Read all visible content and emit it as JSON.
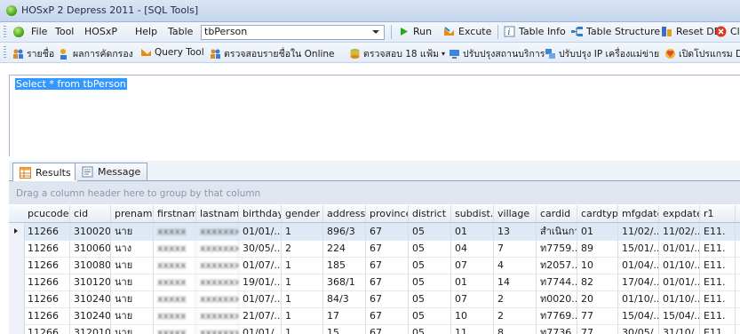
{
  "window": {
    "title": "HOSxP 2 Depress 2011 - [SQL Tools]"
  },
  "menu": {
    "items": [
      "File",
      "Tool",
      "HOSxP",
      "Help",
      "Table"
    ],
    "table_select": "tbPerson",
    "buttons": [
      "Run",
      "Excute",
      "Table Info",
      "Table Structure",
      "Reset DB",
      "Close"
    ]
  },
  "toolbar2": {
    "items": [
      "รายชื่อ",
      "ผลการคัดกรอง",
      "Query Tool",
      "ตรวจสอบรายชื่อใน Online",
      "ตรวจสอบ 18 แฟ้ม",
      "ปรับปรุงสถานบริการ",
      "ปรับปรุง IP เครื่องแม่ข่าย",
      "เปิดโปรแกรม Depress"
    ]
  },
  "editor": {
    "sql": "Select * from tbPerson"
  },
  "tabs": [
    "Results",
    "Message"
  ],
  "grid": {
    "group_hint": "Drag a column header here to group by that column",
    "columns": [
      "pcucode",
      "cid",
      "prename",
      "firstname",
      "lastname",
      "birthday",
      "gender",
      "address",
      "province",
      "district",
      "subdist...",
      "village",
      "cardid",
      "cardtype",
      "mfgdate",
      "expdate",
      "r1"
    ],
    "rows": [
      [
        "11266",
        "310020...",
        "นาย",
        "xxxxx",
        "xxxxxxx",
        "01/01/...",
        "1",
        "896/3",
        "67",
        "05",
        "01",
        "13",
        "สำเนินการ",
        "01",
        "11/02/...",
        "11/02/...",
        "E11."
      ],
      [
        "11266",
        "310060...",
        "นาง",
        "xxxxx",
        "xxxxxxx",
        "30/05/...",
        "2",
        "224",
        "67",
        "05",
        "04",
        "7",
        "ท7759...",
        "89",
        "15/01/...",
        "01/01/...",
        "E11."
      ],
      [
        "11266",
        "310080...",
        "นาย",
        "xxxxx",
        "xxxxxxx",
        "01/07/...",
        "1",
        "185",
        "67",
        "05",
        "07",
        "4",
        "ท2057...",
        "10",
        "01/04/...",
        "01/10/...",
        "E11."
      ],
      [
        "11266",
        "310120...",
        "นาย",
        "xxxxx",
        "xxxxxxx",
        "19/01/...",
        "1",
        "368/1",
        "67",
        "05",
        "01",
        "14",
        "ท7744...",
        "82",
        "17/04/...",
        "01/01/...",
        "E11."
      ],
      [
        "11266",
        "310240...",
        "นาย",
        "xxxxx",
        "xxxxxxx",
        "01/07/...",
        "1",
        "84/3",
        "67",
        "05",
        "07",
        "2",
        "ท0020...",
        "20",
        "01/10/...",
        "01/10/...",
        "E11."
      ],
      [
        "11266",
        "310240...",
        "นาย",
        "xxxxx",
        "xxxxxxx",
        "21/07/...",
        "1",
        "17",
        "67",
        "05",
        "10",
        "2",
        "ท7769...",
        "77",
        "15/04/...",
        "15/04/...",
        "E11."
      ],
      [
        "11266",
        "312010...",
        "นาย",
        "xxxxx",
        "xxxxxxx",
        "01/01/...",
        "1",
        "15",
        "67",
        "05",
        "11",
        "8",
        "ท7736...",
        "77",
        "30/05/...",
        "31/10/...",
        "E11."
      ]
    ]
  },
  "icons": {
    "run": "play-icon",
    "excute": "execute-icon",
    "table_info": "info-icon",
    "table_structure": "structure-icon",
    "reset_db": "reset-db-icon",
    "close": "close-icon"
  },
  "colors": {
    "selection": "#3399ff",
    "run_green": "#2ea51d",
    "close_red": "#d93a1f"
  }
}
